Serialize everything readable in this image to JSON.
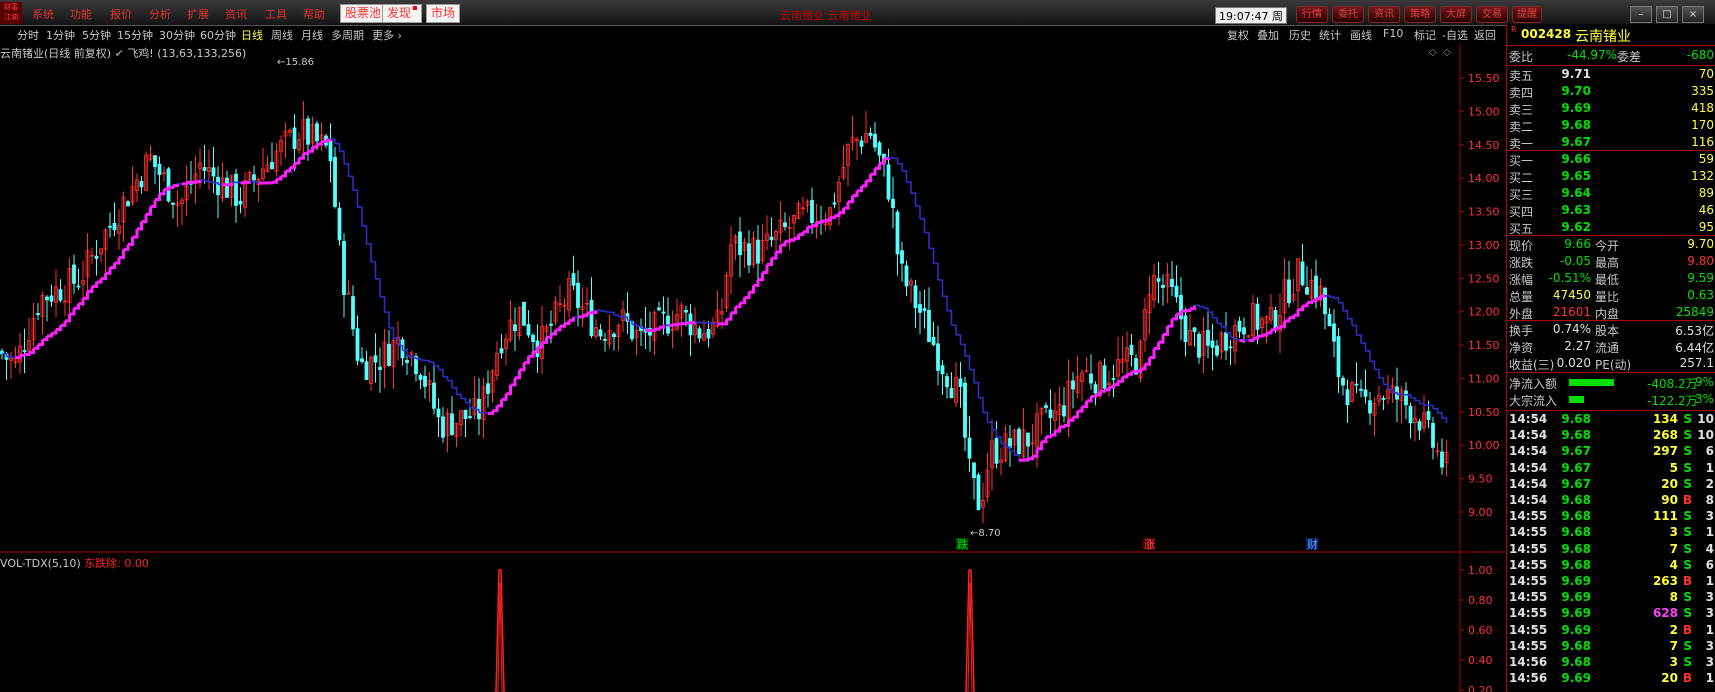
{
  "menu": {
    "logo": "财富\n江湖",
    "items": [
      "系统",
      "功能",
      "报价",
      "分析",
      "扩展",
      "资讯",
      "工具",
      "帮助"
    ],
    "buttons": [
      "股票池",
      "发现",
      "市场"
    ],
    "window_title": "云南锗业 云南锗业",
    "clock": "19:07:47 周五",
    "sys_buttons": [
      "行情",
      "委托",
      "资讯",
      "策略",
      "大屏",
      "交易",
      "提醒"
    ],
    "win_controls": [
      "–",
      "□",
      "×"
    ]
  },
  "periods": [
    "分时",
    "1分钟",
    "5分钟",
    "15分钟",
    "30分钟",
    "60分钟",
    "日线",
    "周线",
    "月线",
    "多周期",
    "更多 ›"
  ],
  "active_period": "日线",
  "right_tools": [
    "复权",
    "叠加",
    "历史",
    "统计",
    "画线",
    "F10",
    "标记",
    "-自选",
    "返回"
  ],
  "chart": {
    "stock_title": "云南锗业(日线 前复权)",
    "indicator": "飞鸡!",
    "params": "(13,63,133,256)",
    "high_label": "15.86",
    "low_label": "8.70",
    "marker_down": "跌",
    "marker_up": "涨",
    "marker_fin": "财",
    "price_ticks": [
      "15.50",
      "15.00",
      "14.50",
      "14.00",
      "13.50",
      "13.00",
      "12.50",
      "12.00",
      "11.50",
      "11.00",
      "10.50",
      "10.00",
      "9.50",
      "9.00"
    ]
  },
  "volume_panel": {
    "title": "VOL-TDX(5,10)",
    "label": "东跌除: 0.00",
    "ticks": [
      "1.00",
      "0.80",
      "0.60",
      "0.40",
      "0.20"
    ]
  },
  "quote": {
    "code": "002428",
    "name": "云南锗业",
    "weibi_label": "委比",
    "weibi": "-44.97%",
    "weicha_label": "委差",
    "weicha": "-680",
    "asks": [
      {
        "label": "卖五",
        "price": "9.71",
        "vol": "70"
      },
      {
        "label": "卖四",
        "price": "9.70",
        "vol": "335"
      },
      {
        "label": "卖三",
        "price": "9.69",
        "vol": "418"
      },
      {
        "label": "卖二",
        "price": "9.68",
        "vol": "170"
      },
      {
        "label": "卖一",
        "price": "9.67",
        "vol": "116"
      }
    ],
    "bids": [
      {
        "label": "买一",
        "price": "9.66",
        "vol": "59"
      },
      {
        "label": "买二",
        "price": "9.65",
        "vol": "132"
      },
      {
        "label": "买三",
        "price": "9.64",
        "vol": "89"
      },
      {
        "label": "买四",
        "price": "9.63",
        "vol": "46"
      },
      {
        "label": "买五",
        "price": "9.62",
        "vol": "95"
      }
    ],
    "stats": [
      {
        "l1": "现价",
        "v1": "9.66",
        "c1": "g",
        "l2": "今开",
        "v2": "9.70",
        "c2": "y"
      },
      {
        "l1": "涨跌",
        "v1": "-0.05",
        "c1": "g",
        "l2": "最高",
        "v2": "9.80",
        "c2": "r"
      },
      {
        "l1": "涨幅",
        "v1": "-0.51%",
        "c1": "g",
        "l2": "最低",
        "v2": "9.59",
        "c2": "g"
      },
      {
        "l1": "总量",
        "v1": "47450",
        "c1": "y",
        "l2": "量比",
        "v2": "0.63",
        "c2": "g"
      },
      {
        "l1": "外盘",
        "v1": "21601",
        "c1": "r",
        "l2": "内盘",
        "v2": "25849",
        "c2": "g"
      }
    ],
    "stats2": [
      {
        "l1": "换手",
        "v1": "0.74%",
        "l2": "股本",
        "v2": "6.53亿"
      },
      {
        "l1": "净资",
        "v1": "2.27",
        "l2": "流通",
        "v2": "6.44亿"
      },
      {
        "l1": "收益(三)",
        "v1": "0.020",
        "l2": "PE(动)",
        "v2": "257.1"
      }
    ],
    "net_inflow": {
      "label": "净流入额",
      "value": "-408.2万",
      "pct": "-9%",
      "bar": 0.9
    },
    "block_inflow": {
      "label": "大宗流入",
      "value": "-122.2万",
      "pct": "-3%",
      "bar": 0.3
    },
    "ticks": [
      {
        "t": "14:54",
        "p": "9.68",
        "v": "134",
        "s": "S",
        "n": "10"
      },
      {
        "t": "14:54",
        "p": "9.68",
        "v": "268",
        "s": "S",
        "n": "10"
      },
      {
        "t": "14:54",
        "p": "9.67",
        "v": "297",
        "s": "S",
        "n": "6"
      },
      {
        "t": "14:54",
        "p": "9.67",
        "v": "5",
        "s": "S",
        "n": "1"
      },
      {
        "t": "14:54",
        "p": "9.67",
        "v": "20",
        "s": "S",
        "n": "2"
      },
      {
        "t": "14:54",
        "p": "9.68",
        "v": "90",
        "s": "B",
        "n": "8"
      },
      {
        "t": "14:55",
        "p": "9.68",
        "v": "111",
        "s": "S",
        "n": "3"
      },
      {
        "t": "14:55",
        "p": "9.68",
        "v": "3",
        "s": "S",
        "n": "1"
      },
      {
        "t": "14:55",
        "p": "9.68",
        "v": "7",
        "s": "S",
        "n": "4"
      },
      {
        "t": "14:55",
        "p": "9.68",
        "v": "4",
        "s": "S",
        "n": "6"
      },
      {
        "t": "14:55",
        "p": "9.69",
        "v": "263",
        "s": "B",
        "n": "1"
      },
      {
        "t": "14:55",
        "p": "9.69",
        "v": "8",
        "s": "S",
        "n": "3"
      },
      {
        "t": "14:55",
        "p": "9.69",
        "v": "628",
        "s": "S",
        "n": "3"
      },
      {
        "t": "14:55",
        "p": "9.69",
        "v": "2",
        "s": "B",
        "n": "1"
      },
      {
        "t": "14:55",
        "p": "9.68",
        "v": "7",
        "s": "S",
        "n": "3"
      },
      {
        "t": "14:56",
        "p": "9.68",
        "v": "3",
        "s": "S",
        "n": "3"
      },
      {
        "t": "14:56",
        "p": "9.69",
        "v": "20",
        "s": "B",
        "n": "1"
      }
    ]
  },
  "colors": {
    "up": "#ff3030",
    "down": "#54ffff",
    "ma_up": "#ff20ff",
    "ma_down": "#3030d0"
  }
}
